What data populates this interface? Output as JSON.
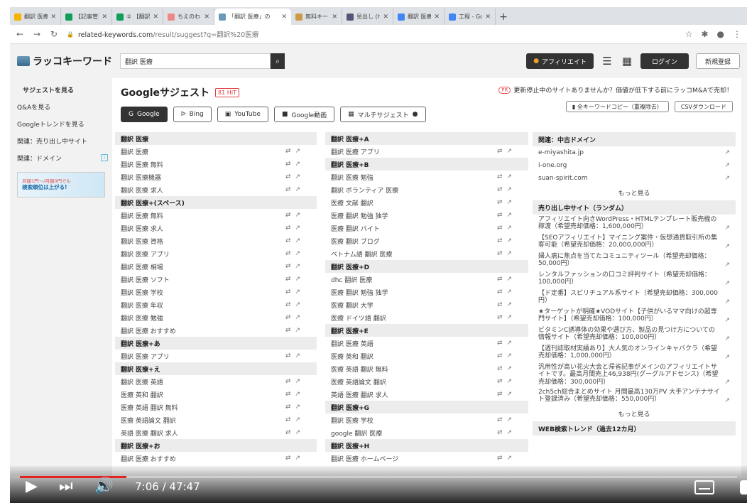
{
  "browser": {
    "tabs": [
      {
        "title": "翻訳 医療 - Goo",
        "color": "#f4b400"
      },
      {
        "title": "【記事管理シー",
        "color": "#0f9d58"
      },
      {
        "title": "② 【翻訳 医療】",
        "color": "#0f9d58"
      },
      {
        "title": "ちえのわ！SEO",
        "color": "#e88"
      },
      {
        "title": "「翻訳 医療」の",
        "color": "#6a9ab8",
        "active": true
      },
      {
        "title": "無料キーワード",
        "color": "#c94"
      },
      {
        "title": "見出し (hタグ)",
        "color": "#557"
      },
      {
        "title": "翻訳 医療 - Goo",
        "color": "#4285f4"
      },
      {
        "title": "工程 - Google",
        "color": "#4285f4"
      }
    ],
    "url_host": "related-keywords.com",
    "url_path": "/result/suggest?q=翻訳%20医療"
  },
  "header": {
    "logo": "ラッコキーワード",
    "search_value": "翻訳 医療",
    "affiliate": "アフィリエイト",
    "login": "ログイン",
    "register": "新規登録"
  },
  "sidebar": {
    "items": [
      {
        "label": "サジェストを見る"
      },
      {
        "label": "Q&Aを見る"
      },
      {
        "label": "Googleトレンドを見る"
      },
      {
        "label": "関連：売り出し中サイト"
      },
      {
        "label": "関連：ドメイン"
      }
    ],
    "banner_line1": "月額1円〜/月額0円でも",
    "banner_line2": "検索順位は上がる!"
  },
  "main": {
    "title": "Googleサジェスト",
    "hit_count": "81 HIT",
    "pr_tag": "PR",
    "pr_text": "更新停止中のサイトありませんか？価値が低下する前にラッコM&Aで売却！",
    "engines": [
      "Google",
      "Bing",
      "YouTube",
      "Google動画",
      "マルチサジェスト"
    ],
    "copy_all": "全キーワードコピー（重複除去）",
    "csv": "CSVダウンロード"
  },
  "col1": [
    {
      "head": "翻訳 医療",
      "items": [
        "翻訳 医療",
        "翻訳 医療 無料",
        "翻訳 医療機器",
        "翻訳 医療 求人"
      ]
    },
    {
      "head": "翻訳 医療+(スペース)",
      "items": [
        "翻訳 医療 無料",
        "翻訳 医療 求人",
        "翻訳 医療 資格",
        "翻訳 医療 アプリ",
        "翻訳 医療 相場",
        "翻訳 医療 ソフト",
        "翻訳 医療 学校",
        "翻訳 医療 年収",
        "翻訳 医療 勉強",
        "翻訳 医療 おすすめ"
      ]
    },
    {
      "head": "翻訳 医療+あ",
      "items": [
        "翻訳 医療 アプリ"
      ]
    },
    {
      "head": "翻訳 医療+え",
      "items": [
        "翻訳 医療 英語",
        "医療 英和 翻訳",
        "医療 英語 翻訳 無料",
        "医療 英語論文 翻訳",
        "英語 医療 翻訳 求人"
      ]
    },
    {
      "head": "翻訳 医療+お",
      "items": [
        "翻訳 医療 おすすめ"
      ]
    }
  ],
  "col2": [
    {
      "head": "翻訳 医療+A",
      "items": [
        "翻訳 医療 アプリ"
      ]
    },
    {
      "head": "翻訳 医療+B",
      "items": [
        "翻訳 医療 勉強",
        "翻訳 ボランティア 医療",
        "医療 文献 翻訳",
        "医療 翻訳 勉強 独学",
        "医療 翻訳 バイト",
        "医療 翻訳 ブログ",
        "ベトナム語 翻訳 医療"
      ]
    },
    {
      "head": "翻訳 医療+D",
      "items": [
        "dhc 翻訳 医療",
        "医療 翻訳 勉強 独学",
        "医療 翻訳 大学",
        "医療 ドイツ語 翻訳"
      ]
    },
    {
      "head": "翻訳 医療+E",
      "items": [
        "翻訳 医療 英語",
        "医療 英和 翻訳",
        "医療 英語 翻訳 無料",
        "医療 英語論文 翻訳",
        "英語 医療 翻訳 求人"
      ]
    },
    {
      "head": "翻訳 医療+G",
      "items": [
        "翻訳 医療 学校",
        "google 翻訳 医療"
      ]
    },
    {
      "head": "翻訳 医療+H",
      "items": [
        "翻訳 医療 ホームページ"
      ]
    }
  ],
  "col3": {
    "domain_head": "関連：中古ドメイン",
    "domains": [
      "e-miyashita.jp",
      "i-one.org",
      "suan-spirit.com"
    ],
    "more": "もっと見る",
    "sites_head": "売り出し中サイト（ランダム）",
    "sites": [
      "アフィリエイト向きWordPress・HTMLテンプレート販売機の稼渡（希望売却価格：1,600,000円）",
      "【SEOアフィリエイト】マイニング案件・仮想通貨取引所の集客可能（希望売却価格：20,000,000円）",
      "婦人病に焦点を当てたコミュニティツール（希望売却価格：50,000円）",
      "レンタルファッションの口コミ評判サイト（希望売却価格：100,000円）",
      "【ド定番】スピリチュアル系サイト（希望売却価格：300,000円）",
      "★ターゲットが明確★VODサイト【子供がいるママ向けの超専門サイト】（希望売却価格：100,000円）",
      "ビタミンC誘導体の効果や選び方、製品の見つけ方についての情報サイト（希望売却価格：100,000円）",
      "【週刊誌取材実績あり】大人気のオンラインキャバクラ（希望売却価格：1,000,000円）",
      "汎用性が高い花火大会と帰省記事がメインのアフィリエイトサイトです。最高月間売上46,938円(グーグルアドセンス)（希望売却価格：300,000円）",
      "2ch5ch総合まとめサイト 月間最高130万PV 大手アンテナサイト登録済み（希望売却価格：550,000円）"
    ],
    "more2": "もっと見る",
    "trend_head": "WEB検索トレンド（過去12カ月）"
  },
  "video": {
    "time": "7:06 / 47:47",
    "progress": 0.149
  }
}
